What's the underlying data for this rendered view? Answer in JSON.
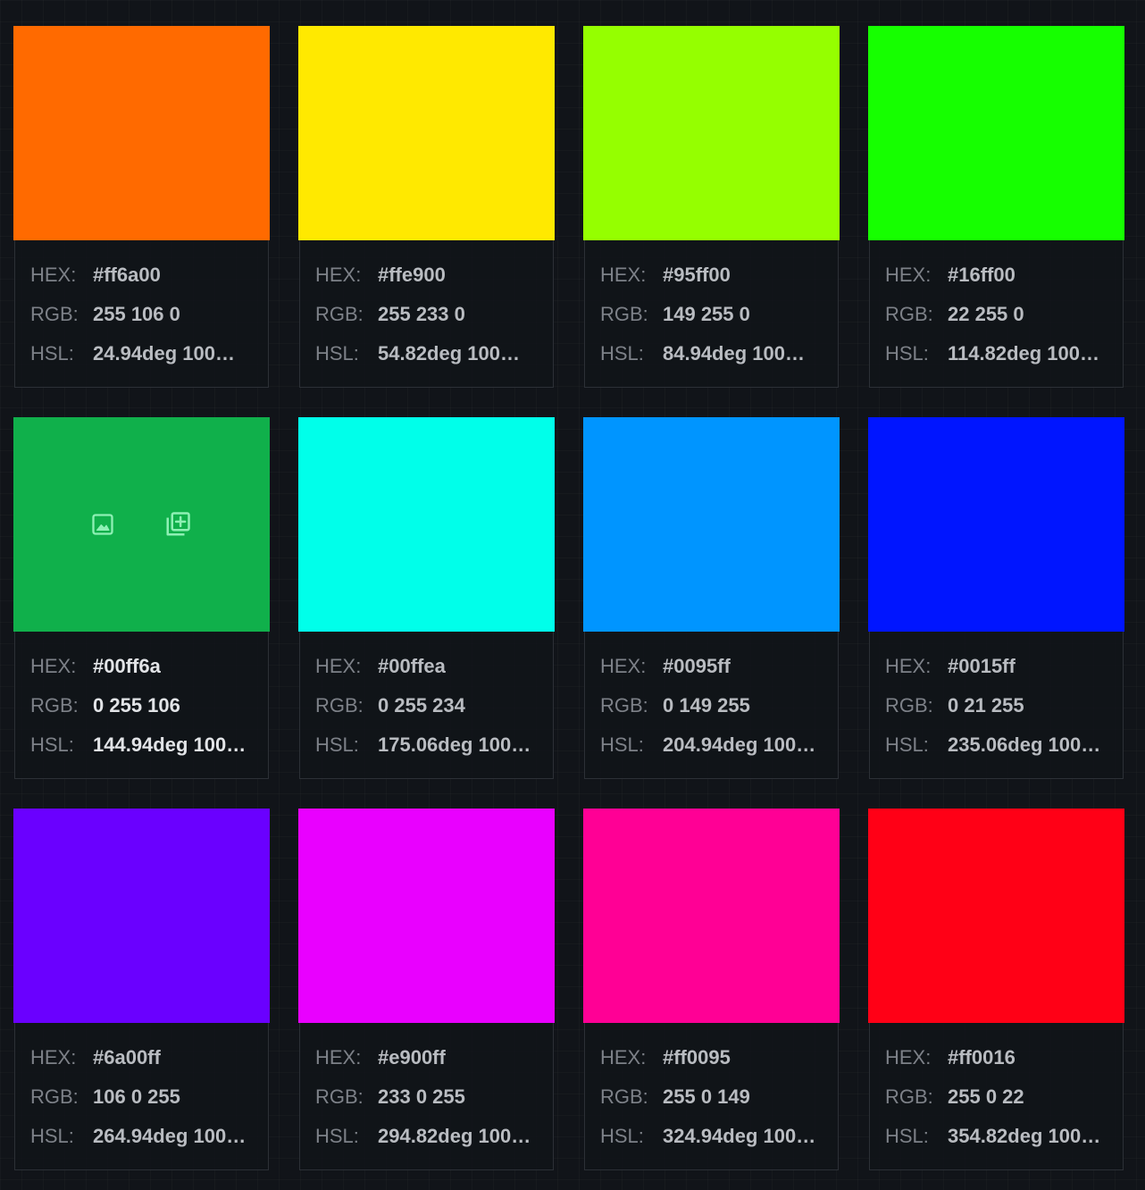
{
  "labels": {
    "hex": "HEX:",
    "rgb": "RGB:",
    "hsl": "HSL:"
  },
  "actions": {
    "icon_color": "#8ef0b4",
    "icons": [
      "image-icon",
      "add-to-collection-icon"
    ]
  },
  "colors": [
    {
      "swatch": "#ff6a00",
      "hex": "#ff6a00",
      "rgb": "255 106 0",
      "hsl": "24.94deg 100…"
    },
    {
      "swatch": "#ffe900",
      "hex": "#ffe900",
      "rgb": "255 233 0",
      "hsl": "54.82deg 100…"
    },
    {
      "swatch": "#95ff00",
      "hex": "#95ff00",
      "rgb": "149 255 0",
      "hsl": "84.94deg 100…"
    },
    {
      "swatch": "#16ff00",
      "hex": "#16ff00",
      "rgb": "22 255 0",
      "hsl": "114.82deg 100…"
    },
    {
      "swatch": "#10b04b",
      "hex": "#00ff6a",
      "rgb": "0 255 106",
      "hsl": "144.94deg 100…"
    },
    {
      "swatch": "#00ffea",
      "hex": "#00ffea",
      "rgb": "0 255 234",
      "hsl": "175.06deg 100…"
    },
    {
      "swatch": "#0095ff",
      "hex": "#0095ff",
      "rgb": "0 149 255",
      "hsl": "204.94deg 100…"
    },
    {
      "swatch": "#0015ff",
      "hex": "#0015ff",
      "rgb": "0 21 255",
      "hsl": "235.06deg 100…"
    },
    {
      "swatch": "#6a00ff",
      "hex": "#6a00ff",
      "rgb": "106 0 255",
      "hsl": "264.94deg 100…"
    },
    {
      "swatch": "#e900ff",
      "hex": "#e900ff",
      "rgb": "233 0 255",
      "hsl": "294.82deg 100…"
    },
    {
      "swatch": "#ff0095",
      "hex": "#ff0095",
      "rgb": "255 0 149",
      "hsl": "324.94deg 100…"
    },
    {
      "swatch": "#ff0016",
      "hex": "#ff0016",
      "rgb": "255 0 22",
      "hsl": "354.82deg 100…"
    }
  ]
}
